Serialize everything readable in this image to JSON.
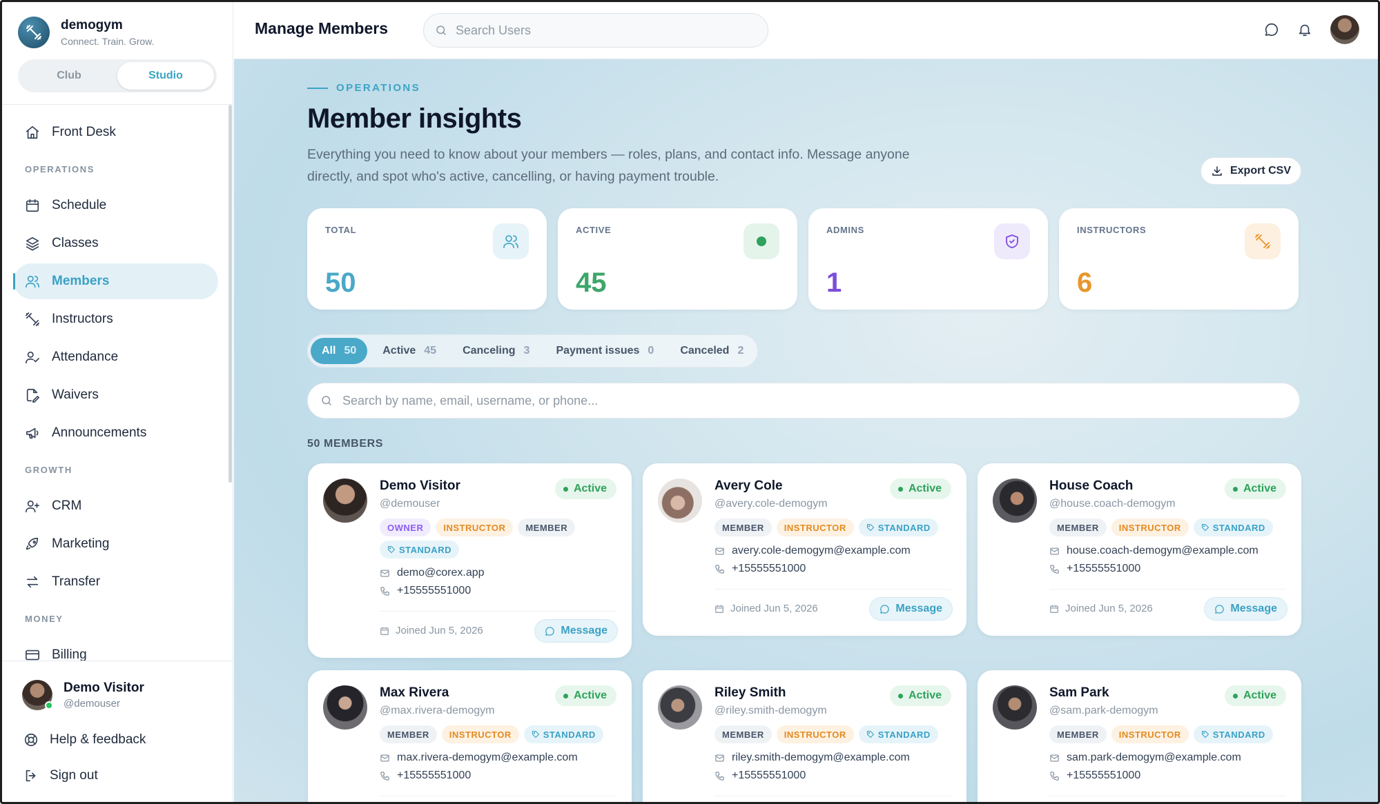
{
  "brand": {
    "name": "demogym",
    "tagline": "Connect. Train. Grow."
  },
  "mode_switch": {
    "options": [
      "Club",
      "Studio"
    ],
    "selected": "Studio"
  },
  "sidebar": {
    "front_desk": "Front Desk",
    "sections": [
      {
        "heading": "OPERATIONS",
        "items": [
          {
            "label": "Schedule",
            "icon": "calendar-icon"
          },
          {
            "label": "Classes",
            "icon": "layers-icon"
          },
          {
            "label": "Members",
            "icon": "users-icon",
            "active": true
          },
          {
            "label": "Instructors",
            "icon": "dumbbell-icon"
          },
          {
            "label": "Attendance",
            "icon": "user-check-icon"
          },
          {
            "label": "Waivers",
            "icon": "file-signature-icon"
          },
          {
            "label": "Announcements",
            "icon": "megaphone-icon"
          }
        ]
      },
      {
        "heading": "GROWTH",
        "items": [
          {
            "label": "CRM",
            "icon": "user-plus-icon"
          },
          {
            "label": "Marketing",
            "icon": "rocket-icon"
          },
          {
            "label": "Transfer",
            "icon": "transfer-icon"
          }
        ]
      },
      {
        "heading": "MONEY",
        "items": [
          {
            "label": "Billing",
            "icon": "credit-card-icon"
          }
        ]
      }
    ],
    "user": {
      "name": "Demo Visitor",
      "handle": "@demouser"
    },
    "help": "Help & feedback",
    "signout": "Sign out"
  },
  "topbar": {
    "title": "Manage Members",
    "search_placeholder": "Search Users"
  },
  "page": {
    "eyebrow": "OPERATIONS",
    "title": "Member insights",
    "description": "Everything you need to know about your members — roles, plans, and contact info. Message anyone directly, and spot who's active, cancelling, or having payment trouble.",
    "export_label": "Export CSV"
  },
  "stats": [
    {
      "label": "TOTAL",
      "value": "50",
      "color": "#4aa8c8",
      "icon": "users-icon"
    },
    {
      "label": "ACTIVE",
      "value": "45",
      "color": "#3da66a",
      "icon": "status-dot-icon"
    },
    {
      "label": "ADMINS",
      "value": "1",
      "color": "#7c4ddb",
      "icon": "shield-icon"
    },
    {
      "label": "INSTRUCTORS",
      "value": "6",
      "color": "#e8962b",
      "icon": "dumbbell-icon"
    }
  ],
  "filters": [
    {
      "label": "All",
      "count": "50",
      "active": true
    },
    {
      "label": "Active",
      "count": "45"
    },
    {
      "label": "Canceling",
      "count": "3"
    },
    {
      "label": "Payment issues",
      "count": "0"
    },
    {
      "label": "Canceled",
      "count": "2"
    }
  ],
  "member_search_placeholder": "Search by name, email, username, or phone...",
  "members_count_label": "50 MEMBERS",
  "members": [
    {
      "name": "Demo Visitor",
      "username": "@demouser",
      "status": "Active",
      "roles": [
        "OWNER",
        "INSTRUCTOR",
        "MEMBER"
      ],
      "plan": "STANDARD",
      "email": "demo@corex.app",
      "phone": "+15555551000",
      "joined": "Joined Jun 5, 2026",
      "message": "Message"
    },
    {
      "name": "Avery Cole",
      "username": "@avery.cole-demogym",
      "status": "Active",
      "roles": [
        "MEMBER",
        "INSTRUCTOR"
      ],
      "plan": "STANDARD",
      "email": "avery.cole-demogym@example.com",
      "phone": "+15555551000",
      "joined": "Joined Jun 5, 2026",
      "message": "Message"
    },
    {
      "name": "House Coach",
      "username": "@house.coach-demogym",
      "status": "Active",
      "roles": [
        "MEMBER",
        "INSTRUCTOR"
      ],
      "plan": "STANDARD",
      "email": "house.coach-demogym@example.com",
      "phone": "+15555551000",
      "joined": "Joined Jun 5, 2026",
      "message": "Message"
    },
    {
      "name": "Max Rivera",
      "username": "@max.rivera-demogym",
      "status": "Active",
      "roles": [
        "MEMBER",
        "INSTRUCTOR"
      ],
      "plan": "STANDARD",
      "email": "max.rivera-demogym@example.com",
      "phone": "+15555551000"
    },
    {
      "name": "Riley Smith",
      "username": "@riley.smith-demogym",
      "status": "Active",
      "roles": [
        "MEMBER",
        "INSTRUCTOR"
      ],
      "plan": "STANDARD",
      "email": "riley.smith-demogym@example.com",
      "phone": "+15555551000"
    },
    {
      "name": "Sam Park",
      "username": "@sam.park-demogym",
      "status": "Active",
      "roles": [
        "MEMBER",
        "INSTRUCTOR"
      ],
      "plan": "STANDARD",
      "email": "sam.park-demogym@example.com",
      "phone": "+15555551000"
    }
  ]
}
